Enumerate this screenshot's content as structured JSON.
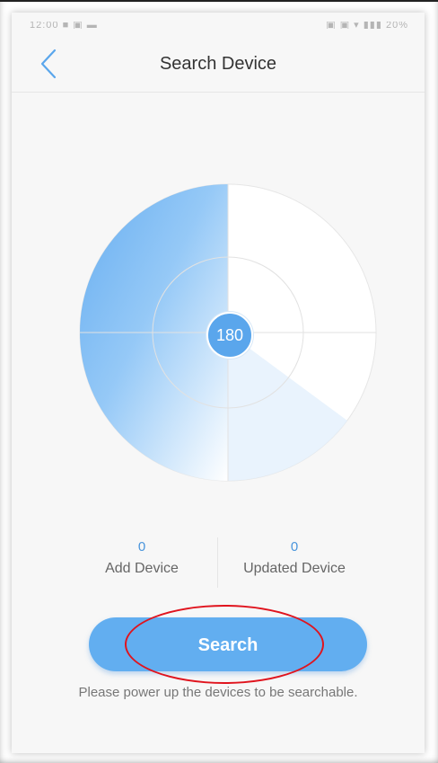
{
  "statusbar": {
    "left_text": "12:00 ■ ▣ ▬",
    "right_text": "▣ ▣ ▾ ▮▮▮ 20%"
  },
  "navbar": {
    "back_icon": "chevron-left-icon",
    "title": "Search Device"
  },
  "radar": {
    "countdown": "180",
    "sweep_progress": 0.5,
    "colors": {
      "sweep_start": "#5aa7ef",
      "sweep_end": "#ffffff",
      "rings": "#e2e2e2",
      "badge": "#5aa6ec"
    }
  },
  "stats": {
    "add_device": {
      "value": "0",
      "label": "Add Device"
    },
    "updated_device": {
      "value": "0",
      "label": "Updated Device"
    }
  },
  "search_button": {
    "label": "Search"
  },
  "hint": "Please power up the devices to be searchable.",
  "colors": {
    "accent": "#62aef0",
    "highlight": "#e0141e"
  }
}
